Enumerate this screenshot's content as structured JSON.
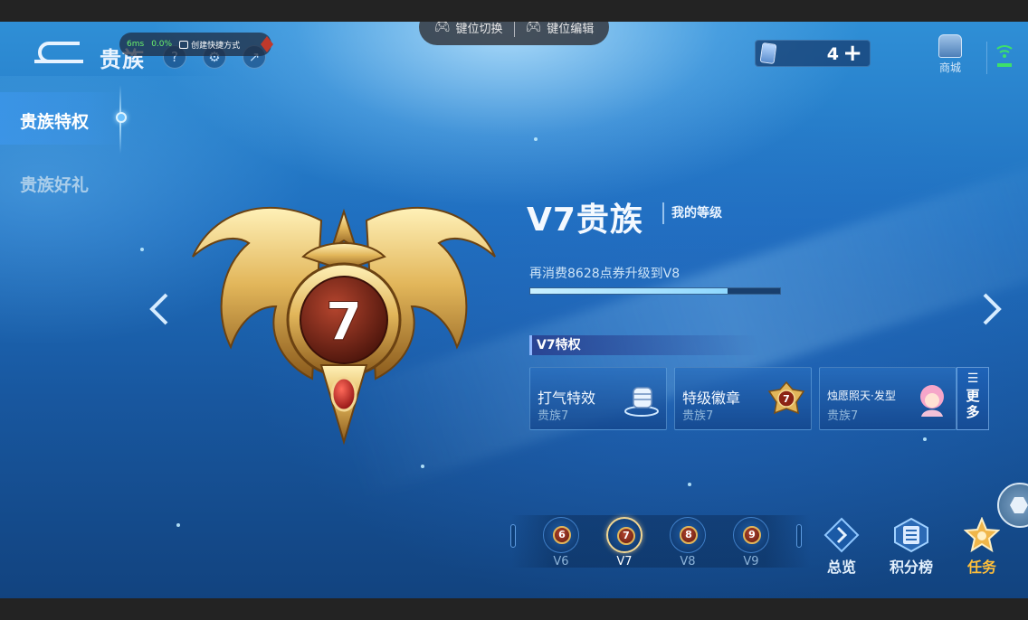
{
  "header": {
    "title": "贵族",
    "icons": [
      "back-icon",
      "help-icon",
      "settings-icon",
      "share-icon"
    ]
  },
  "perf_overlay": {
    "latency": "6ms",
    "loss": "0.0%",
    "shortcut_label": "创建快捷方式"
  },
  "keybar": {
    "switch_label": "键位切换",
    "edit_label": "键位编辑"
  },
  "top_right": {
    "ticket_count": "4",
    "shop_label": "商城"
  },
  "sidebar": {
    "items": [
      {
        "label": "贵族特权",
        "active": true
      },
      {
        "label": "贵族好礼",
        "active": false
      }
    ]
  },
  "level": {
    "emblem_number": "7",
    "title": "V7贵族",
    "my_level_label": "我的等级",
    "upgrade_text": "再消费8628点券升级到V8",
    "progress": 0.79
  },
  "privileges": {
    "header": "V7特权",
    "cards": [
      {
        "name": "打气特效",
        "sub": "贵族7",
        "icon": "fist-icon"
      },
      {
        "name": "特级徽章",
        "sub": "贵族7",
        "icon": "badge-icon"
      },
      {
        "name": "烛愿照天·发型",
        "sub": "贵族7",
        "icon": "hero-avatar-icon"
      }
    ],
    "more_label": "更多"
  },
  "level_selector": {
    "levels": [
      {
        "label": "V6",
        "num": "6",
        "selected": false
      },
      {
        "label": "V7",
        "num": "7",
        "selected": true
      },
      {
        "label": "V8",
        "num": "8",
        "selected": false
      },
      {
        "label": "V9",
        "num": "9",
        "selected": false
      }
    ]
  },
  "bottom_buttons": {
    "overview": "总览",
    "leaderboard": "积分榜",
    "task": "任务"
  },
  "colors": {
    "gold": "#e2b65a",
    "task_orange": "#ffbf3a",
    "progress_fill": "#bfeeff",
    "bg_blue": "#1f6fbf"
  }
}
